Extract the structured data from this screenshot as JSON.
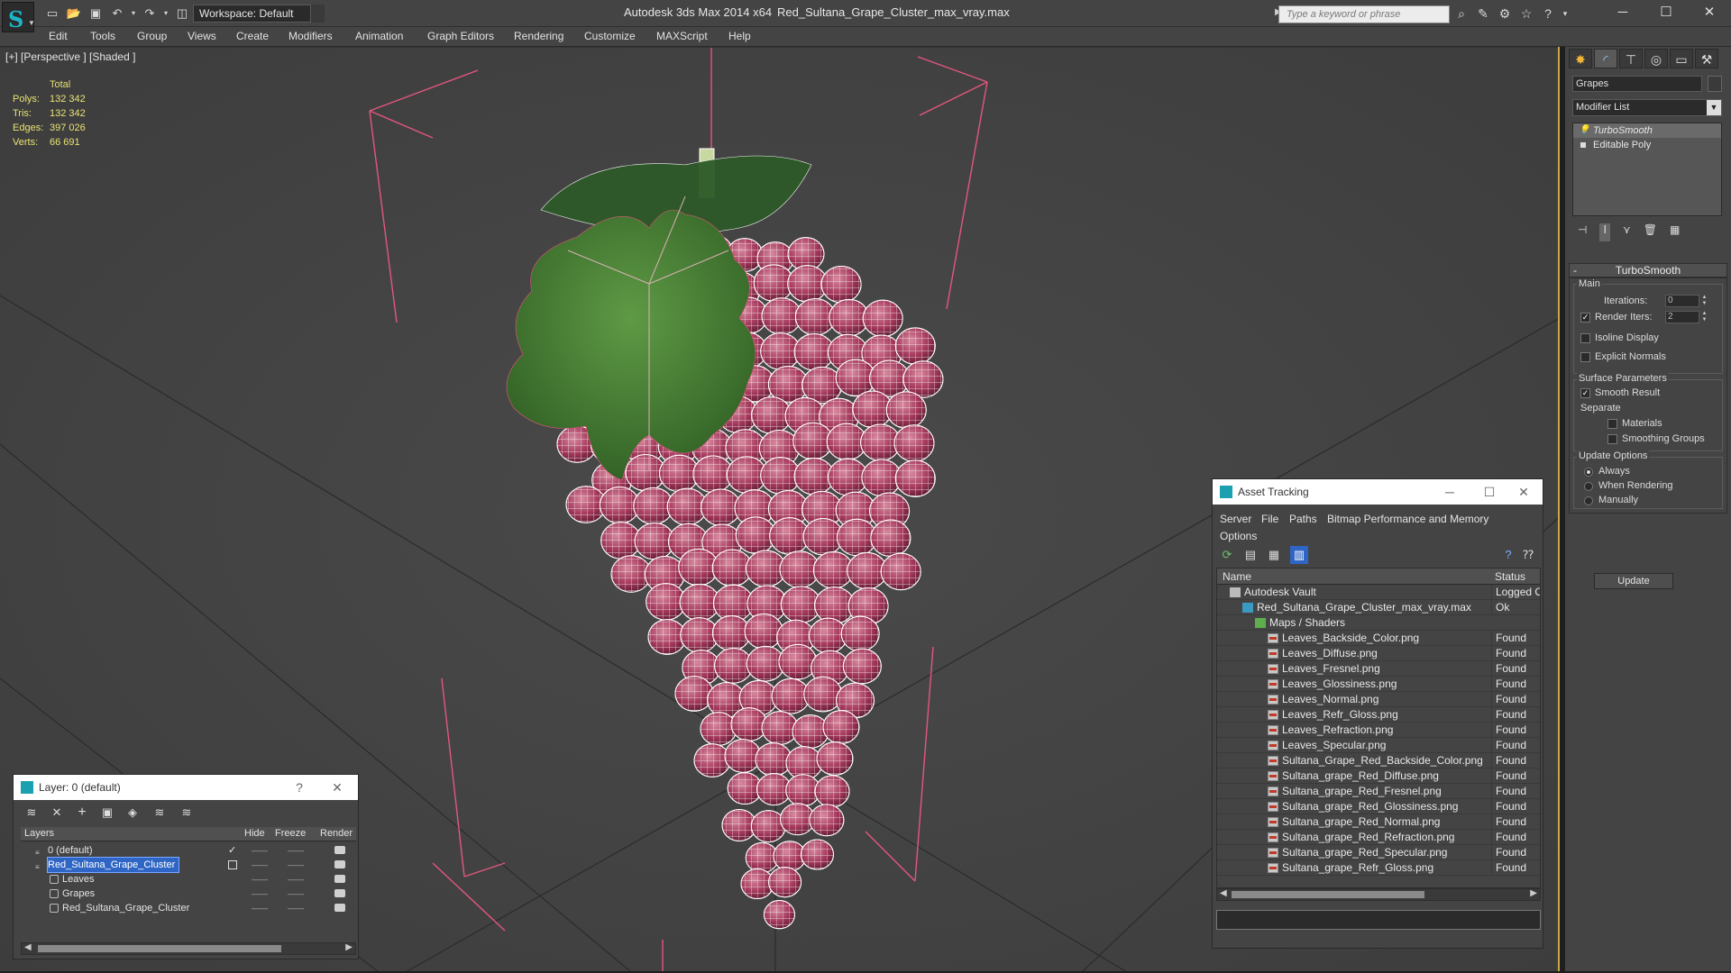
{
  "titlebar": {
    "workspace": "Workspace: Default",
    "app_title": "Autodesk 3ds Max  2014 x64",
    "file_title": "Red_Sultana_Grape_Cluster_max_vray.max",
    "search_placeholder": "Type a keyword or phrase"
  },
  "menu": [
    "Edit",
    "Tools",
    "Group",
    "Views",
    "Create",
    "Modifiers",
    "Animation",
    "Graph Editors",
    "Rendering",
    "Customize",
    "MAXScript",
    "Help"
  ],
  "viewport": {
    "label": "[+] [Perspective ] [Shaded ]",
    "stats": {
      "header": "Total",
      "polys_label": "Polys:",
      "polys": "132 342",
      "tris_label": "Tris:",
      "tris": "132 342",
      "edges_label": "Edges:",
      "edges": "397 026",
      "verts_label": "Verts:",
      "verts": "66 691"
    },
    "colors": {
      "wire": "#ffffff",
      "grape": "#a23a55",
      "leaf": "#3e7a2f",
      "bbox": "#e0557a",
      "grid": "#2f2f2f"
    }
  },
  "command_panel": {
    "object_name": "Grapes",
    "modifier_list": "Modifier List",
    "stack": [
      "TurboSmooth",
      "Editable Poly"
    ],
    "rollout_title": "TurboSmooth",
    "main_group": "Main",
    "iterations_label": "Iterations:",
    "iterations": "0",
    "render_iters_label": "Render Iters:",
    "render_iters": "2",
    "render_iters_checked": true,
    "isoline_label": "Isoline Display",
    "explicit_normals_label": "Explicit Normals",
    "surface_group": "Surface Parameters",
    "smooth_result_label": "Smooth Result",
    "smooth_result_checked": true,
    "separate_label": "Separate",
    "materials_label": "Materials",
    "smoothing_groups_label": "Smoothing Groups",
    "update_group": "Update Options",
    "always_label": "Always",
    "when_rendering_label": "When Rendering",
    "manually_label": "Manually",
    "update_button": "Update"
  },
  "asset_tracking": {
    "title": "Asset Tracking",
    "menu": [
      "Server",
      "File",
      "Paths",
      "Bitmap Performance and Memory",
      "Options"
    ],
    "col_name": "Name",
    "col_status": "Status",
    "rows": [
      {
        "name": "Autodesk Vault",
        "status": "Logged Ou",
        "level": 0,
        "icon": "vault"
      },
      {
        "name": "Red_Sultana_Grape_Cluster_max_vray.max",
        "status": "Ok",
        "level": 1,
        "icon": "max"
      },
      {
        "name": "Maps / Shaders",
        "status": "",
        "level": 2,
        "icon": "folder"
      },
      {
        "name": "Leaves_Backside_Color.png",
        "status": "Found",
        "level": 3,
        "icon": "png"
      },
      {
        "name": "Leaves_Diffuse.png",
        "status": "Found",
        "level": 3,
        "icon": "png"
      },
      {
        "name": "Leaves_Fresnel.png",
        "status": "Found",
        "level": 3,
        "icon": "png"
      },
      {
        "name": "Leaves_Glossiness.png",
        "status": "Found",
        "level": 3,
        "icon": "png"
      },
      {
        "name": "Leaves_Normal.png",
        "status": "Found",
        "level": 3,
        "icon": "png"
      },
      {
        "name": "Leaves_Refr_Gloss.png",
        "status": "Found",
        "level": 3,
        "icon": "png"
      },
      {
        "name": "Leaves_Refraction.png",
        "status": "Found",
        "level": 3,
        "icon": "png"
      },
      {
        "name": "Leaves_Specular.png",
        "status": "Found",
        "level": 3,
        "icon": "png"
      },
      {
        "name": "Sultana_Grape_Red_Backside_Color.png",
        "status": "Found",
        "level": 3,
        "icon": "png"
      },
      {
        "name": "Sultana_grape_Red_Diffuse.png",
        "status": "Found",
        "level": 3,
        "icon": "png"
      },
      {
        "name": "Sultana_grape_Red_Fresnel.png",
        "status": "Found",
        "level": 3,
        "icon": "png"
      },
      {
        "name": "Sultana_grape_Red_Glossiness.png",
        "status": "Found",
        "level": 3,
        "icon": "png"
      },
      {
        "name": "Sultana_grape_Red_Normal.png",
        "status": "Found",
        "level": 3,
        "icon": "png"
      },
      {
        "name": "Sultana_grape_Red_Refraction.png",
        "status": "Found",
        "level": 3,
        "icon": "png"
      },
      {
        "name": "Sultana_grape_Red_Specular.png",
        "status": "Found",
        "level": 3,
        "icon": "png"
      },
      {
        "name": "Sultana_grape_Refr_Gloss.png",
        "status": "Found",
        "level": 3,
        "icon": "png"
      }
    ]
  },
  "layer_dialog": {
    "title": "Layer: 0 (default)",
    "help": "?",
    "col_layers": "Layers",
    "col_hide": "Hide",
    "col_freeze": "Freeze",
    "col_render": "Render",
    "rows": [
      {
        "name": "0 (default)",
        "level": 0,
        "kind": "layer",
        "active": true
      },
      {
        "name": "Red_Sultana_Grape_Cluster",
        "level": 0,
        "kind": "layer",
        "selected": true
      },
      {
        "name": "Leaves",
        "level": 1,
        "kind": "object"
      },
      {
        "name": "Grapes",
        "level": 1,
        "kind": "object"
      },
      {
        "name": "Red_Sultana_Grape_Cluster",
        "level": 1,
        "kind": "object"
      }
    ]
  }
}
